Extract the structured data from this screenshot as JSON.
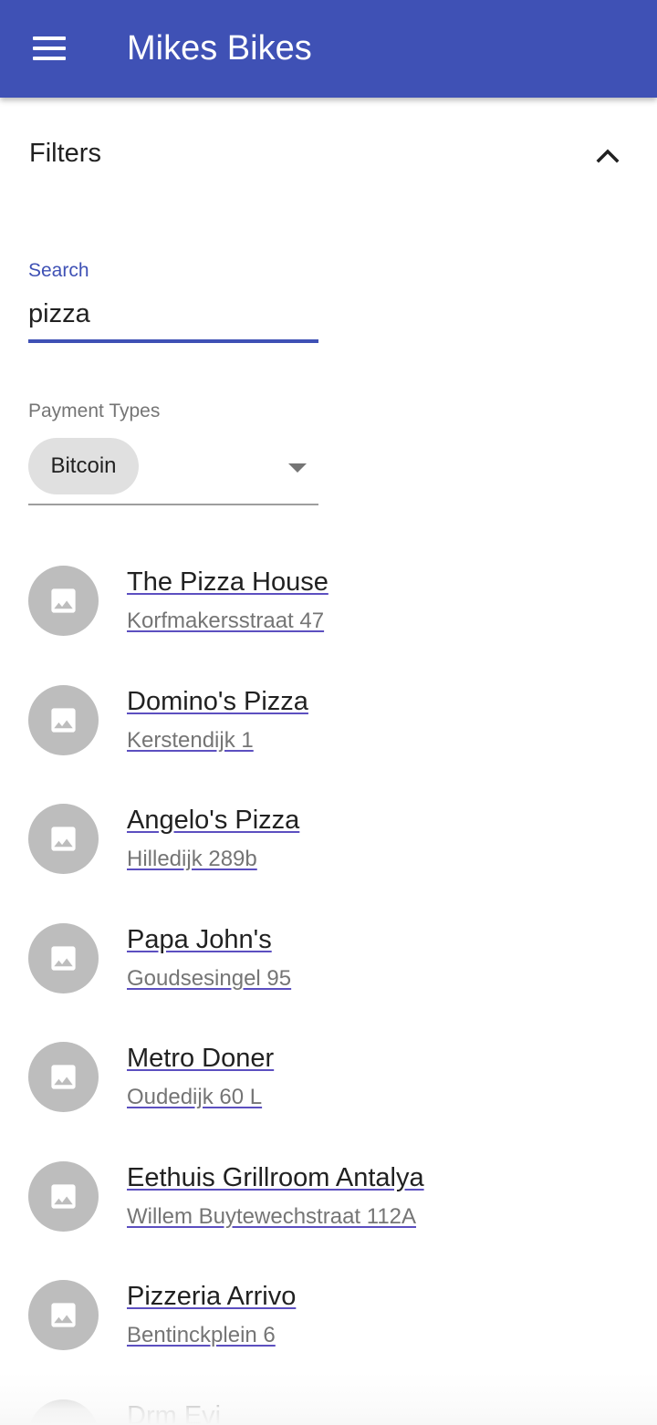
{
  "appbar": {
    "title": "Mikes Bikes",
    "color": "#3f51b5",
    "menu_icon": "menu-icon"
  },
  "filters": {
    "title": "Filters",
    "collapse_icon": "chevron-up-icon",
    "search": {
      "label": "Search",
      "value": "pizza"
    },
    "payment_types": {
      "label": "Payment Types",
      "selected": [
        "Bitcoin"
      ],
      "dropdown_icon": "arrow-drop-down-icon"
    }
  },
  "results": [
    {
      "name": "The Pizza House",
      "address": "Korfmakersstraat 47"
    },
    {
      "name": "Domino's Pizza",
      "address": "Kerstendijk 1"
    },
    {
      "name": "Angelo's Pizza",
      "address": "Hilledijk 289b"
    },
    {
      "name": "Papa John's",
      "address": "Goudsesingel 95"
    },
    {
      "name": "Metro Doner",
      "address": "Oudedijk 60 L"
    },
    {
      "name": "Eethuis Grillroom Antalya",
      "address": "Willem Buytewechstraat 112A"
    },
    {
      "name": "Pizzeria Arrivo",
      "address": "Bentinckplein 6"
    },
    {
      "name": "Drm Evi",
      "address": ""
    }
  ]
}
